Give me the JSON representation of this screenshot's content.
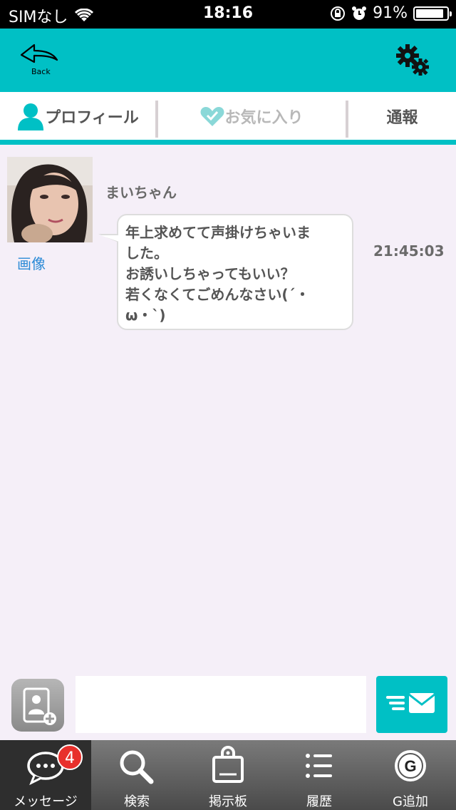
{
  "status_bar": {
    "carrier": "SIMなし",
    "time": "18:16",
    "battery_percent": "91%",
    "battery_level": 0.91
  },
  "header": {
    "back_label": "Back"
  },
  "tabs": {
    "profile": "プロフィール",
    "favorite": "お気に入り",
    "report": "通報"
  },
  "message": {
    "sender": "まいちゃん",
    "image_link": "画像",
    "lines": [
      " 年上求めてて声掛けちゃいま",
      "した。",
      "お誘いしちゃってもいい？",
      "若くなくてごめんなさい(´・",
      "ω・`)"
    ],
    "time": "21:45:03"
  },
  "composer": {
    "placeholder": ""
  },
  "bottom_nav": {
    "messages": "メッセージ",
    "messages_badge": "4",
    "search": "検索",
    "board": "掲示板",
    "history": "履歴",
    "g_add": "G追加"
  },
  "colors": {
    "accent": "#00c0c5",
    "background": "#f5eff8",
    "badge": "#e8302c",
    "link": "#2a8ad6"
  }
}
